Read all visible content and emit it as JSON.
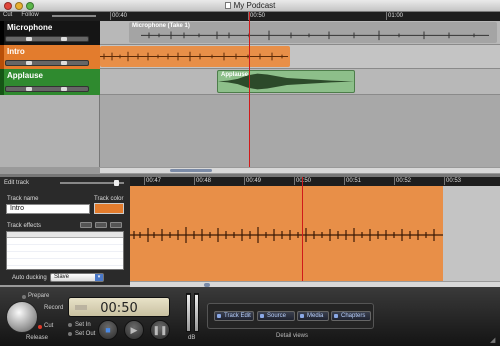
{
  "window": {
    "title": "My Podcast"
  },
  "toolbar": {
    "cut_label": "Cut",
    "follow_label": "Follow"
  },
  "ruler_top": [
    "00:40",
    "00:50",
    "01:00"
  ],
  "tracks": [
    {
      "name": "Microphone",
      "color": "#111111",
      "region_label": "Microphone (Take 1)",
      "region_color": "#a4a4a4"
    },
    {
      "name": "Intro",
      "color": "#e37c2d",
      "region_label": "",
      "region_color": "#e88f48"
    },
    {
      "name": "Applause",
      "color": "#2f8a2f",
      "region_label": "Applause",
      "region_color": "#8dbf8a"
    }
  ],
  "edit_track": {
    "panel_title": "Edit track",
    "track_name_label": "Track name",
    "track_name_value": "Intro",
    "track_color_label": "Track color",
    "track_color_value": "#e37c2d",
    "effects_label": "Track effects",
    "auto_ducking_label": "Auto ducking",
    "auto_ducking_value": "Slave"
  },
  "edit_ruler": [
    "00:47",
    "00:48",
    "00:49",
    "00:50",
    "00:51",
    "00:52",
    "00:53"
  ],
  "transport": {
    "time": "00:50",
    "prepare_label": "Prepare",
    "record_label": "Record",
    "cut_label": "Cut",
    "release_label": "Release",
    "set_in_label": "Set In",
    "set_out_label": "Set Out",
    "meter_label": "dB"
  },
  "detail_views": {
    "caption": "Detail views",
    "buttons": [
      "Track Edit",
      "Source",
      "Media",
      "Chapters"
    ]
  },
  "colors": {
    "playhead": "#d01a1a",
    "accent_orange": "#e37c2d",
    "accent_green": "#2f8a2f"
  }
}
